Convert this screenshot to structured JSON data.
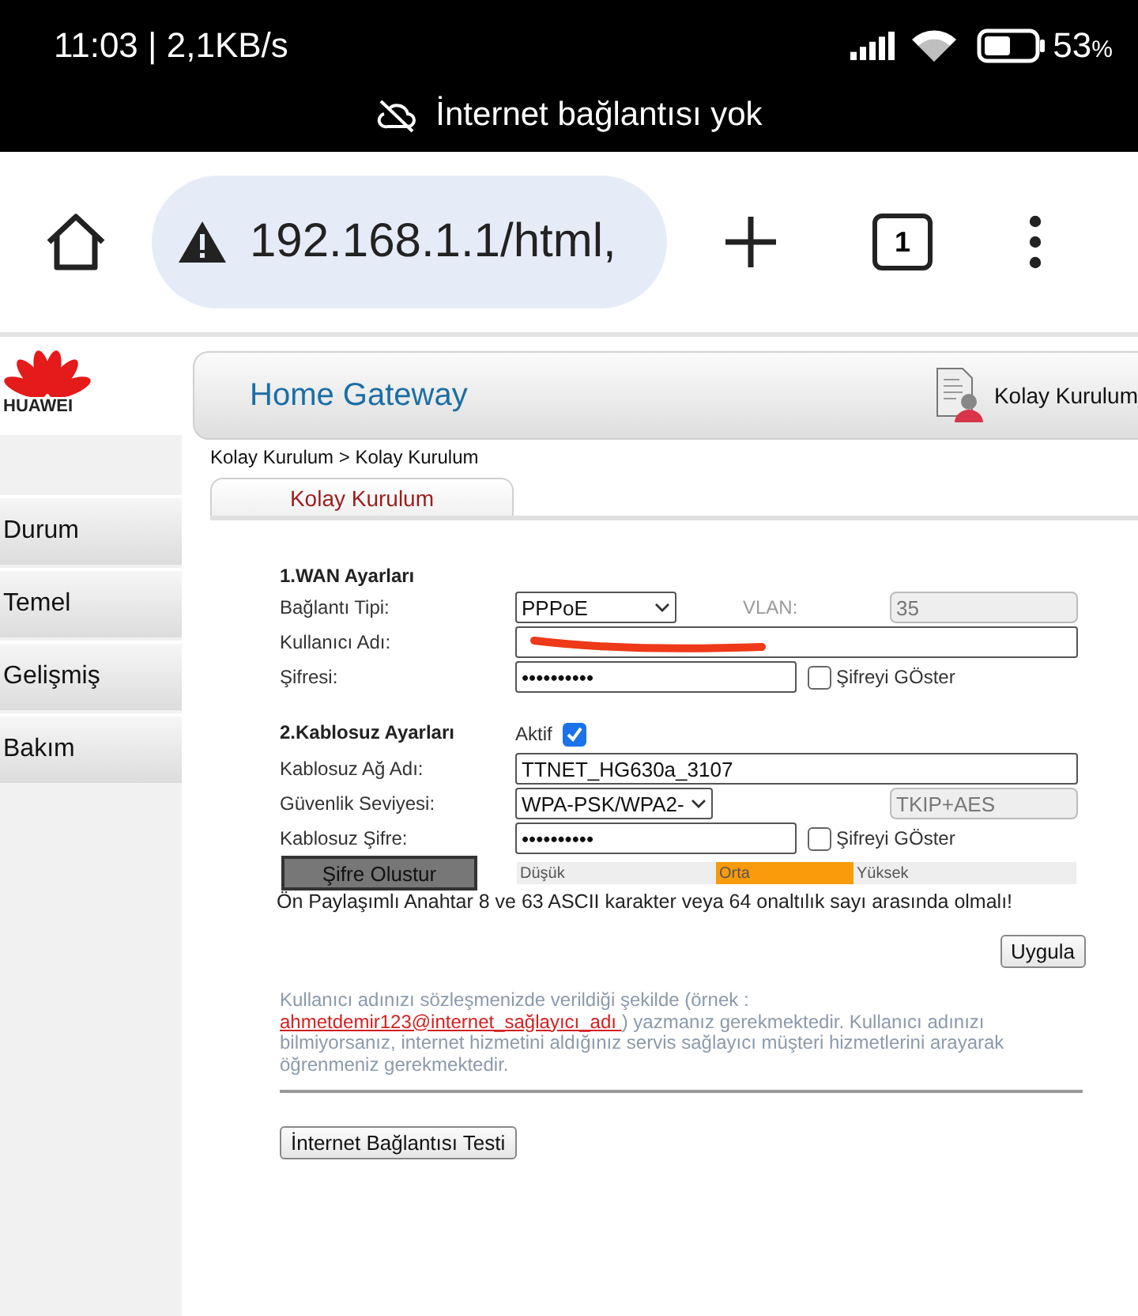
{
  "status_bar": {
    "time": "11:03 | 2,1KB/s",
    "battery": "53",
    "battery_unit": "%",
    "notice": "İnternet bağlantısı yok"
  },
  "browser": {
    "url": "192.168.1.1/html,",
    "tab_count": "1"
  },
  "header": {
    "brand": "HUAWEI",
    "title": "Home Gateway",
    "user_label": "Kolay Kurulum"
  },
  "sidebar": {
    "items": [
      {
        "label": "Durum"
      },
      {
        "label": "Temel"
      },
      {
        "label": "Gelişmiş"
      },
      {
        "label": "Bakım"
      }
    ]
  },
  "breadcrumb": "Kolay Kurulum > Kolay Kurulum",
  "tabs": [
    {
      "label": "Kolay Kurulum",
      "selected": true
    }
  ],
  "wan": {
    "title": "1.WAN Ayarları",
    "connection_label": "Bağlantı Tipi:",
    "connection_value": "PPPoE",
    "vlan_label": "VLAN:",
    "vlan_value": "35",
    "username_label": "Kullanıcı Adı:",
    "username_redacted": true,
    "password_label": "Şifresi:",
    "password_value": "••••••••••",
    "show_label": "Şifreyi GÖster",
    "show_checked": false
  },
  "wireless": {
    "title": "2.Kablosuz Ayarları",
    "active_label": "Aktif",
    "active_checked": true,
    "ssid_label": "Kablosuz Ağ Adı:",
    "ssid_value": "TTNET_HG630a_3107",
    "security_label": "Güvenlik Seviyesi:",
    "security_value": "WPA-PSK/WPA2-",
    "encryption_value": "TKIP+AES",
    "password_label": "Kablosuz Şifre:",
    "password_value": "••••••••••",
    "show_label": "Şifreyi GÖster",
    "show_checked": false,
    "generate_button": "Şifre Olustur",
    "strength": [
      {
        "label": "Düşük",
        "selected": false
      },
      {
        "label": "Orta",
        "selected": true
      },
      {
        "label": "Yüksek",
        "selected": false
      }
    ],
    "hint": "Ön Paylaşımlı Anahtar 8 ve 63 ASCII karakter veya 64 onaltılık sayı arasında olmalı!"
  },
  "apply_button": "Uygula",
  "note": {
    "before": "Kullanıcı adınızı sözleşmenizde verildiği şekilde (örnek :",
    "link": "ahmetdemir123@internet_sağlayıcı_adı ",
    "after": ") yazmanız gerekmektedir. Kullanıcı adınızı bilmiyorsanız, internet hizmetini aldığınız servis sağlayıcı müşteri hizmetlerini arayarak öğrenmeniz gerekmektedir."
  },
  "test_button": "İnternet Bağlantısı Testi"
}
